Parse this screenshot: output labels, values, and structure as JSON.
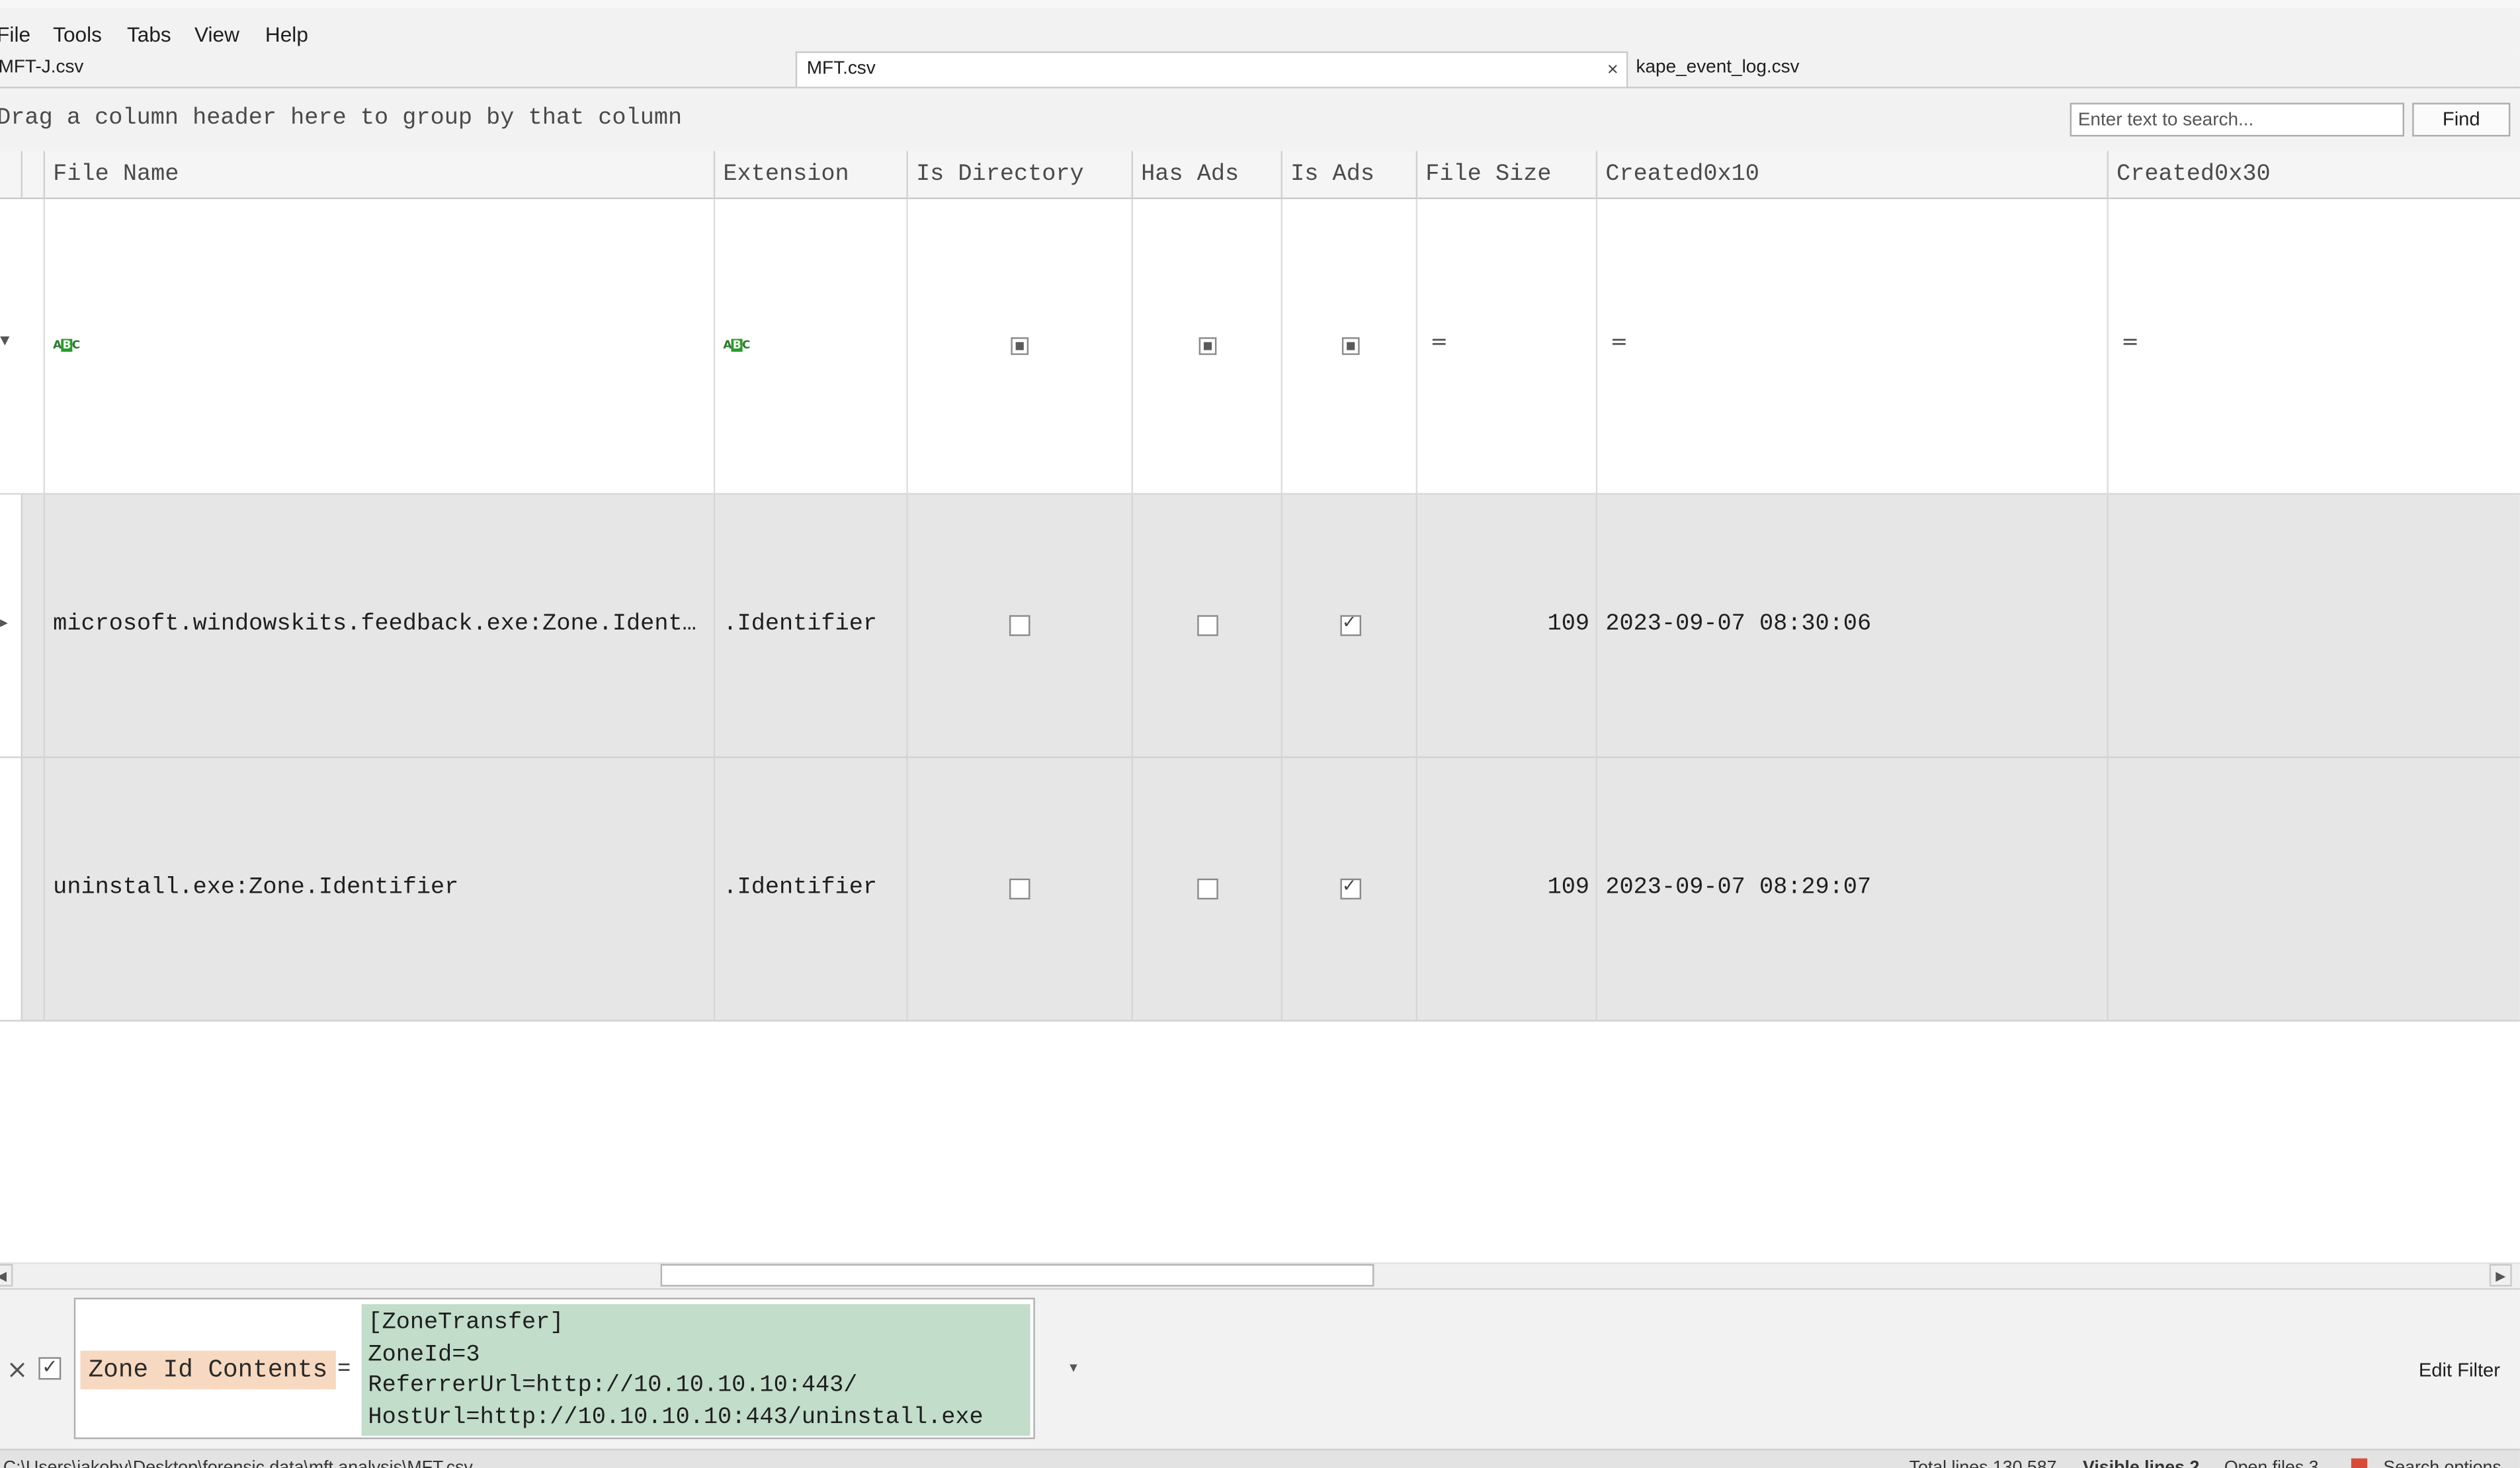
{
  "menu": {
    "file": "File",
    "tools": "Tools",
    "tabs": "Tabs",
    "view": "View",
    "help": "Help"
  },
  "tabs": [
    {
      "label": "MFT-J.csv",
      "active": false
    },
    {
      "label": "MFT.csv",
      "active": true
    },
    {
      "label": "kape_event_log.csv",
      "active": false
    }
  ],
  "tab_close_glyph": "×",
  "group_panel": {
    "hint": "Drag a column header here to group by that column",
    "search_placeholder": "Enter text to search...",
    "find_label": "Find"
  },
  "grid": {
    "columns": [
      "File Name",
      "Extension",
      "Is Directory",
      "Has Ads",
      "Is Ads",
      "File Size",
      "Created0x10",
      "Created0x30"
    ],
    "filter_row": {
      "abc_icon": "abc-filter-icon",
      "eq_glyph": "="
    },
    "rows": [
      {
        "file_name": "microsoft.windowskits.feedback.exe:Zone.Identifier",
        "extension": ".Identifier",
        "is_directory": false,
        "has_ads": false,
        "is_ads": true,
        "file_size": "109",
        "created_0x10": "2023-09-07 08:30:06",
        "created_0x30": ""
      },
      {
        "file_name": "uninstall.exe:Zone.Identifier",
        "extension": ".Identifier",
        "is_directory": false,
        "has_ads": false,
        "is_ads": true,
        "file_size": "109",
        "created_0x10": "2023-09-07 08:29:07",
        "created_0x30": ""
      }
    ]
  },
  "filter_panel": {
    "enabled": true,
    "field": "Zone Id Contents",
    "operator": "=",
    "value": "[ZoneTransfer]\nZoneId=3\nReferrerUrl=http://10.10.10.10:443/\nHostUrl=http://10.10.10.10:443/uninstall.exe",
    "edit_filter_label": "Edit Filter",
    "highlight_colors": {
      "field": "#f6d9c0",
      "value": "#c2ddca"
    }
  },
  "status_bar": {
    "path": "C:\\Users\\jakoby\\Desktop\\forensic data\\mft analysis\\MFT.csv",
    "total_lines": "Total lines 130,587",
    "visible_lines": "Visible lines 2",
    "open_files": "Open files 3",
    "search_option": "Search options"
  }
}
